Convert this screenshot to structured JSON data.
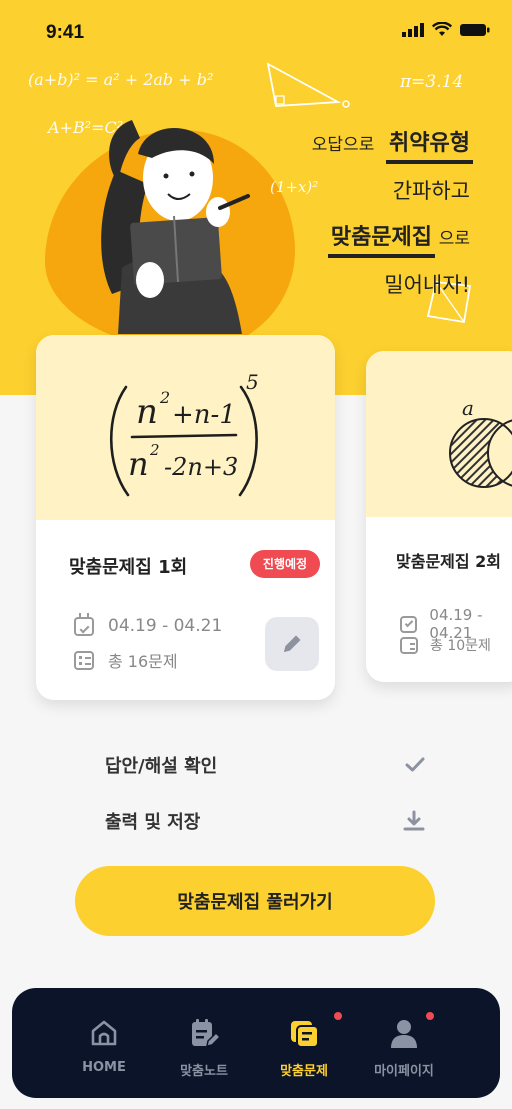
{
  "status_bar": {
    "time": "9:41"
  },
  "hero": {
    "doodles": [
      "(a+b)² = a² + 2ab + b²",
      "A+B²=C²",
      "π=3.14",
      "(1+x)²"
    ],
    "slogan": {
      "line1_prefix": "오답으로",
      "line1_em": "취약유형",
      "line2": "간파하고",
      "line3_em": "맞춤문제집",
      "line3_suffix": "으로",
      "line4": "밀어내자!"
    }
  },
  "cards": [
    {
      "title": "맞춤문제집 1회",
      "badge": "진행예정",
      "date": "04.19 - 04.21",
      "count": "총 16문제"
    },
    {
      "title": "맞춤문제집 2회",
      "date": "04.19 - 04.21",
      "count": "총 10문제",
      "venn_label": "a"
    }
  ],
  "actions": {
    "answers": "답안/해설 확인",
    "print": "출력 및 저장"
  },
  "cta": "맞춤문제집 풀러가기",
  "tabs": [
    {
      "label": "HOME",
      "icon": "home-icon"
    },
    {
      "label": "맞춤노트",
      "icon": "note-edit-icon"
    },
    {
      "label": "맞춤문제",
      "icon": "problems-icon",
      "active": true
    },
    {
      "label": "마이페이지",
      "icon": "person-icon"
    }
  ],
  "colors": {
    "accent": "#fcd02e",
    "badge": "#f04b52",
    "tabbar": "#0b1428",
    "blob": "#f6a70e"
  }
}
